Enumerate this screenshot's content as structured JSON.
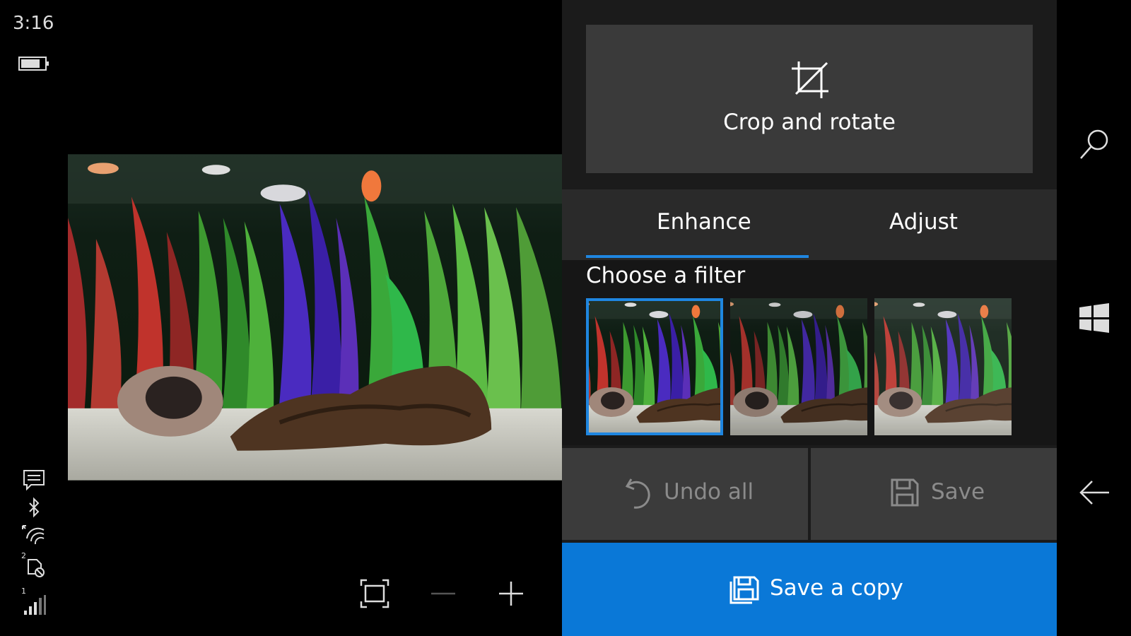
{
  "status": {
    "time": "3:16",
    "icons": [
      "message-icon",
      "bluetooth-icon",
      "wifi-icon",
      "rotation-lock-icon",
      "signal-icon"
    ],
    "sim_numbers": [
      "2",
      "1"
    ]
  },
  "editor": {
    "crop_label": "Crop and rotate",
    "tabs": [
      {
        "label": "Enhance",
        "selected": true
      },
      {
        "label": "Adjust",
        "selected": false
      }
    ],
    "filter_title": "Choose a filter",
    "filters_selected_index": 0,
    "undo_label": "Undo all",
    "save_label": "Save",
    "save_copy_label": "Save a copy",
    "accent": "#1f86e0",
    "save_copy_color": "#0a78d7"
  },
  "zoom": {
    "icons": [
      "fit-screen-icon",
      "zoom-out-icon",
      "zoom-in-icon"
    ]
  },
  "nav": {
    "icons": [
      "search-icon",
      "windows-icon",
      "back-icon"
    ]
  }
}
